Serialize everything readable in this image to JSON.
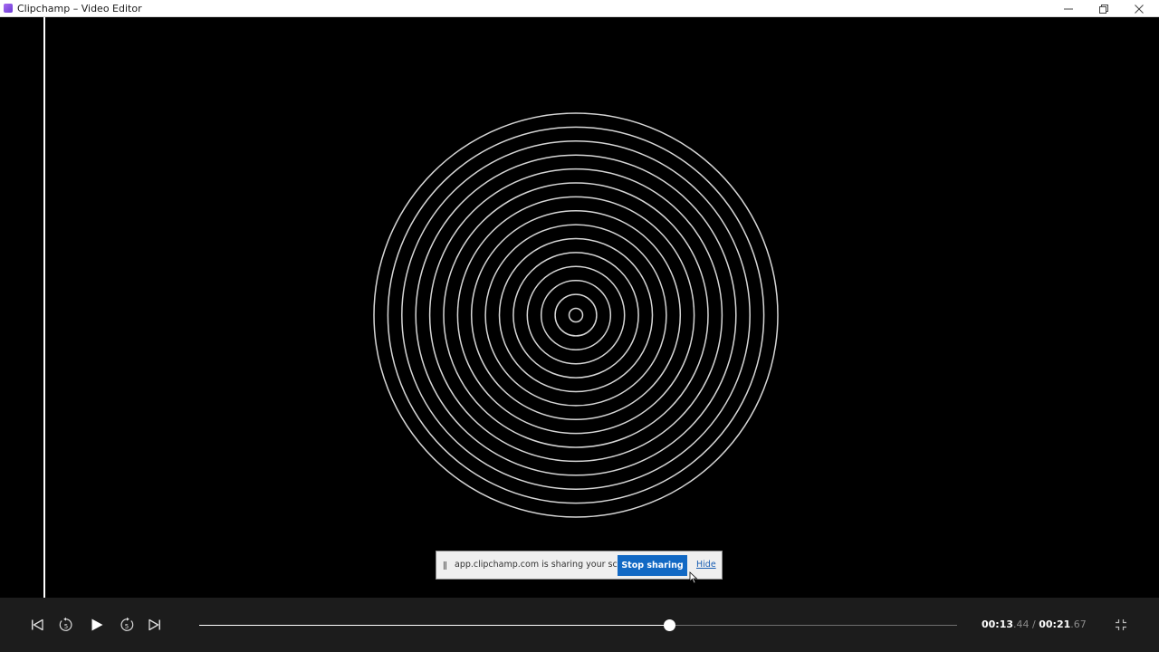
{
  "window": {
    "title": "Clipchamp – Video Editor",
    "icon": "clipchamp-app-icon",
    "buttons": [
      "minimize",
      "restore",
      "close"
    ]
  },
  "preview": {
    "content": "concentric-circles",
    "ring_count": 15
  },
  "share_banner": {
    "message": "app.clipchamp.com is sharing your screen.",
    "stop_label": "Stop sharing",
    "hide_label": "Hide",
    "stop_color": "#1269c4"
  },
  "player": {
    "buttons": [
      "skip-to-start",
      "rewind-5s",
      "play",
      "forward-5s",
      "skip-to-end",
      "exit-fullscreen"
    ],
    "rewind_seconds": "5",
    "forward_seconds": "5",
    "progress_fraction": 0.62,
    "current_time_main": "00:13",
    "current_time_frac": ".44",
    "separator": "/",
    "total_time_main": "00:21",
    "total_time_frac": ".67"
  }
}
